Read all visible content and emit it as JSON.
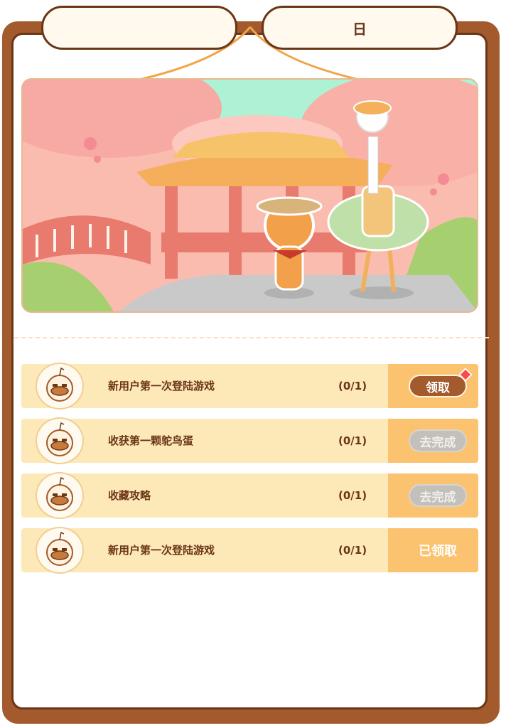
{
  "tabs": {
    "left_label": "",
    "right_label": "日"
  },
  "tasks": [
    {
      "title": "新用户第一次登陆游戏",
      "progress": "(0/1)",
      "action": "领取",
      "state": "claim",
      "has_badge": true
    },
    {
      "title": "收获第一颗鸵鸟蛋",
      "progress": "(0/1)",
      "action": "去完成",
      "state": "go",
      "has_badge": false
    },
    {
      "title": "收藏攻略",
      "progress": "(0/1)",
      "action": "去完成",
      "state": "go",
      "has_badge": false
    },
    {
      "title": "新用户第一次登陆游戏",
      "progress": "(0/1)",
      "action": "已领取",
      "state": "done",
      "has_badge": false
    }
  ],
  "icons": {
    "task_avatar": "ostrich-face-icon",
    "badge": "red-diamond-badge-icon"
  },
  "colors": {
    "frame": "#a35a2c",
    "row_bg": "#fde8b8",
    "action_bg": "#fbc270",
    "claim_button": "#a35a2c",
    "disabled_button": "#c3bfba",
    "text": "#6b3516"
  }
}
